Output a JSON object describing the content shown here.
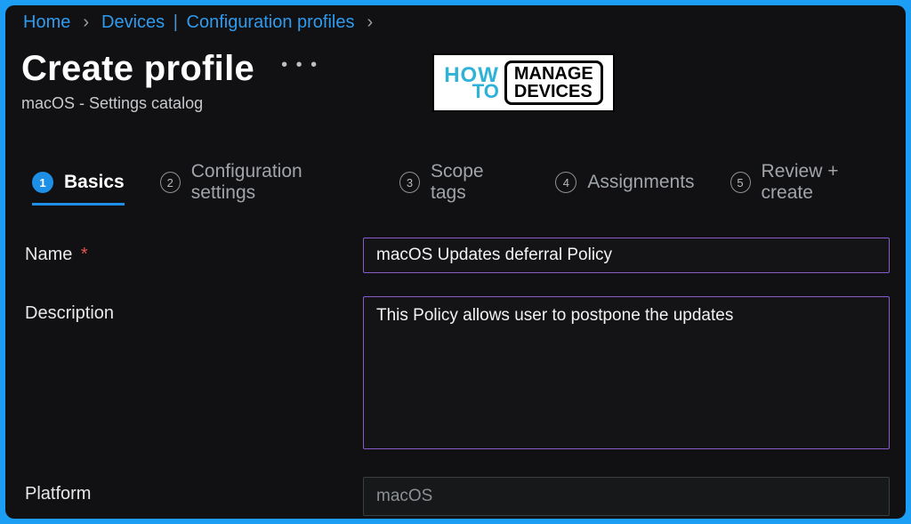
{
  "breadcrumb": {
    "home": "Home",
    "devices": "Devices",
    "profiles": "Configuration profiles"
  },
  "header": {
    "title": "Create profile",
    "subtitle": "macOS - Settings catalog"
  },
  "logo": {
    "how": "HOW",
    "to": "TO",
    "line1": "MANAGE",
    "line2": "DEVICES"
  },
  "tabs": {
    "t1": "Basics",
    "t2": "Configuration settings",
    "t3": "Scope tags",
    "t4": "Assignments",
    "t5": "Review + create",
    "n1": "1",
    "n2": "2",
    "n3": "3",
    "n4": "4",
    "n5": "5"
  },
  "form": {
    "name_label": "Name",
    "name_value": "macOS Updates deferral Policy",
    "desc_label": "Description",
    "desc_value": "This Policy allows user to postpone the updates",
    "platform_label": "Platform",
    "platform_value": "macOS"
  }
}
